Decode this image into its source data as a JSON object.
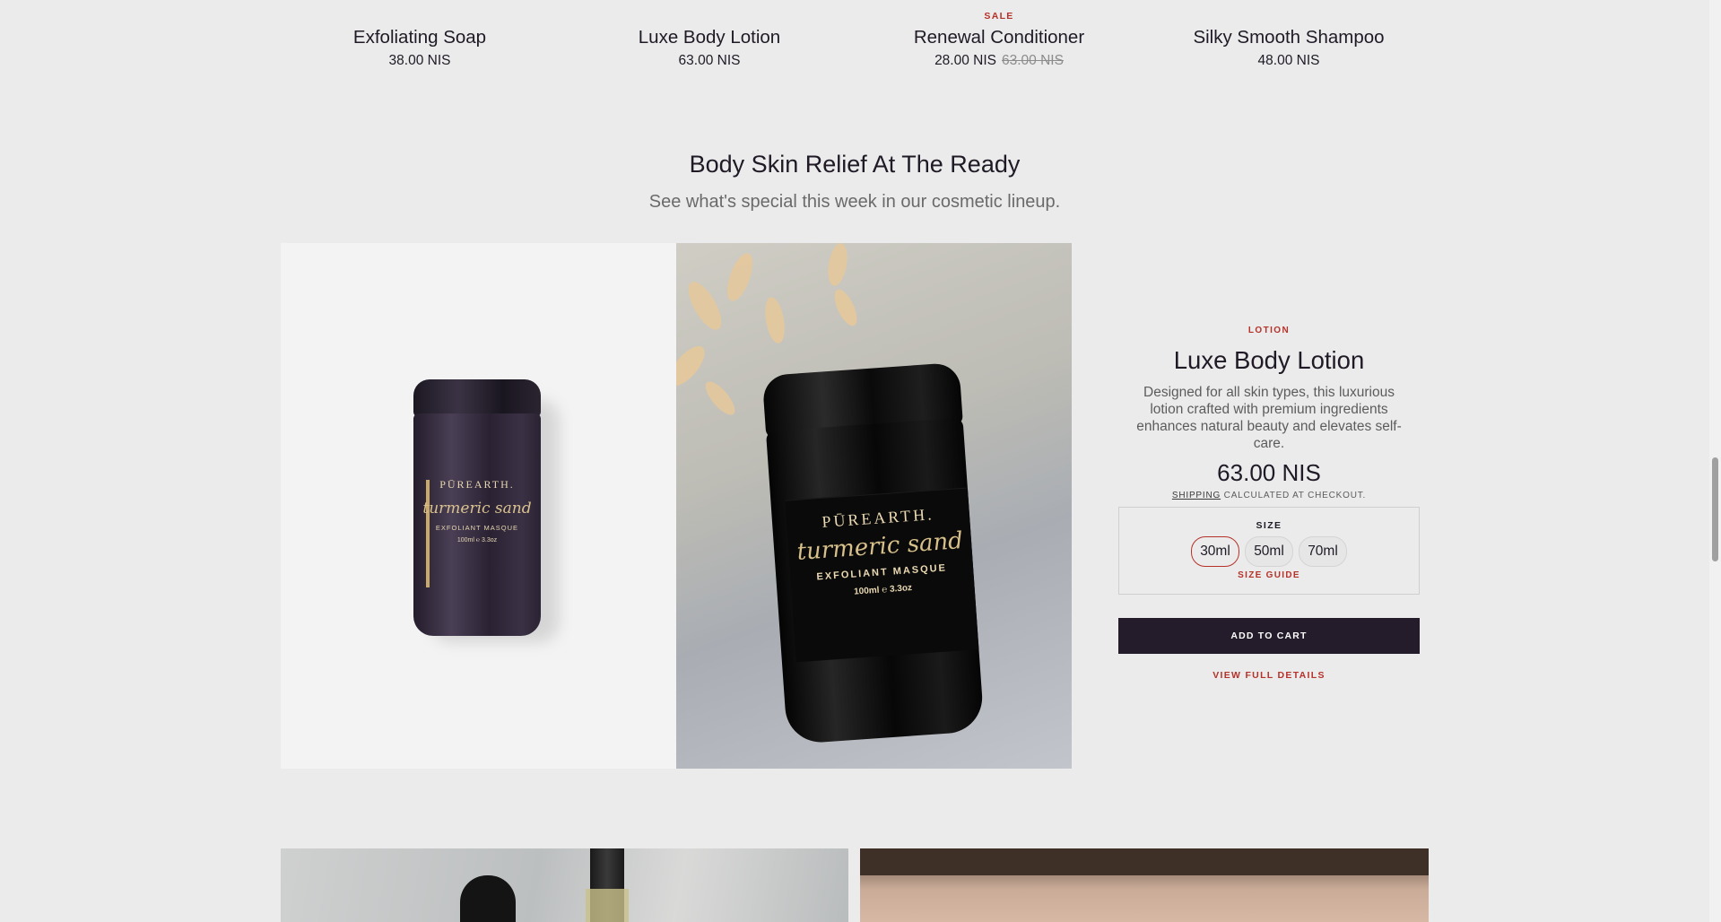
{
  "products": [
    {
      "badge": "",
      "name": "Exfoliating Soap",
      "price": "38.00 NIS",
      "compare_price": ""
    },
    {
      "badge": "",
      "name": "Luxe Body Lotion",
      "price": "63.00 NIS",
      "compare_price": ""
    },
    {
      "badge": "SALE",
      "name": "Renewal Conditioner",
      "price": "28.00 NIS",
      "compare_price": "63.00 NIS"
    },
    {
      "badge": "",
      "name": "Silky Smooth Shampoo",
      "price": "48.00 NIS",
      "compare_price": ""
    }
  ],
  "featured": {
    "title": "Body Skin Relief At The Ready",
    "subtitle": "See what's special this week in our cosmetic lineup.",
    "image_left_alt": {
      "brand": "PŪREARTH.",
      "script": "turmeric sand",
      "type": "EXFOLIANT MASQUE",
      "volume": "100ml ℮ 3.3oz"
    },
    "image_right_alt": {
      "brand": "PŪREARTH.",
      "script": "turmeric sand",
      "type": "EXFOLIANT MASQUE",
      "volume": "100ml ℮ 3.3oz"
    },
    "product": {
      "category": "LOTION",
      "name": "Luxe Body Lotion",
      "description": "Designed for all skin types, this luxurious lotion crafted with premium ingredients enhances natural beauty and elevates self-care.",
      "price": "63.00 NIS",
      "shipping_link": "SHIPPING",
      "shipping_text": "CALCULATED AT CHECKOUT.",
      "size_label": "SIZE",
      "sizes": [
        "30ml",
        "50ml",
        "70ml"
      ],
      "selected_size": "30ml",
      "size_guide": "SIZE GUIDE",
      "add_to_cart": "ADD TO CART",
      "view_details": "VIEW FULL DETAILS"
    }
  },
  "colors": {
    "accent": "#b5322a",
    "button_bg": "#241c2b",
    "page_bg": "#ebebeb"
  }
}
